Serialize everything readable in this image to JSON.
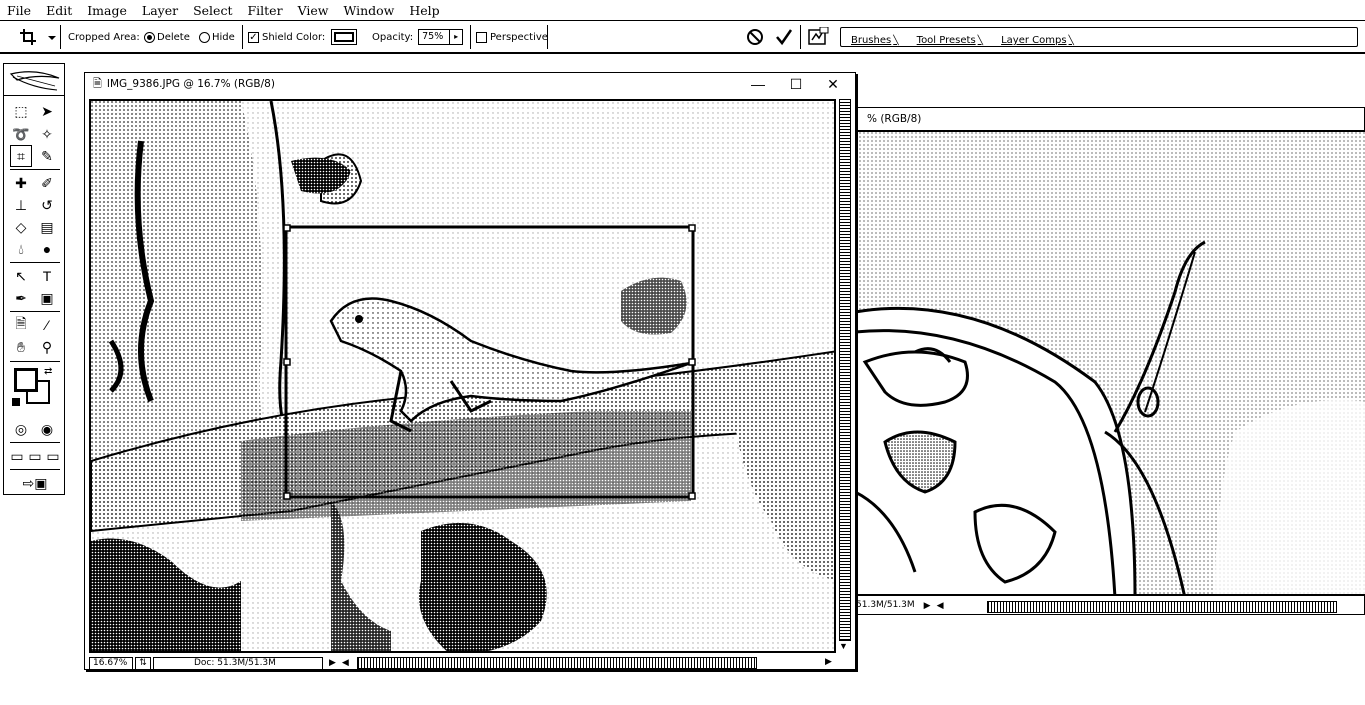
{
  "menu": [
    "File",
    "Edit",
    "Image",
    "Layer",
    "Select",
    "Filter",
    "View",
    "Window",
    "Help"
  ],
  "options": {
    "cropped_area_label": "Cropped Area:",
    "delete_label": "Delete",
    "hide_label": "Hide",
    "shield_label": "Shield",
    "color_label": "Color:",
    "opacity_label": "Opacity:",
    "opacity_value": "75%",
    "perspective_label": "Perspective",
    "shield_checked": true,
    "perspective_checked": false,
    "cropped_area_selected": "Delete"
  },
  "palette_well": {
    "tabs": [
      "Brushes",
      "Tool Presets",
      "Layer Comps"
    ]
  },
  "front_window": {
    "title": "IMG_9386.JPG @ 16.7% (RGB/8)",
    "zoom": "16.67%",
    "doc_info": "Doc: 51.3M/51.3M"
  },
  "back_window": {
    "title_fragment": "% (RGB/8)",
    "doc_info": "51.3M/51.3M"
  },
  "icons": {
    "crop_tool": "crop-icon",
    "cancel": "cancel-icon",
    "commit": "checkmark-icon",
    "palette_toggle": "palette-well-icon"
  }
}
